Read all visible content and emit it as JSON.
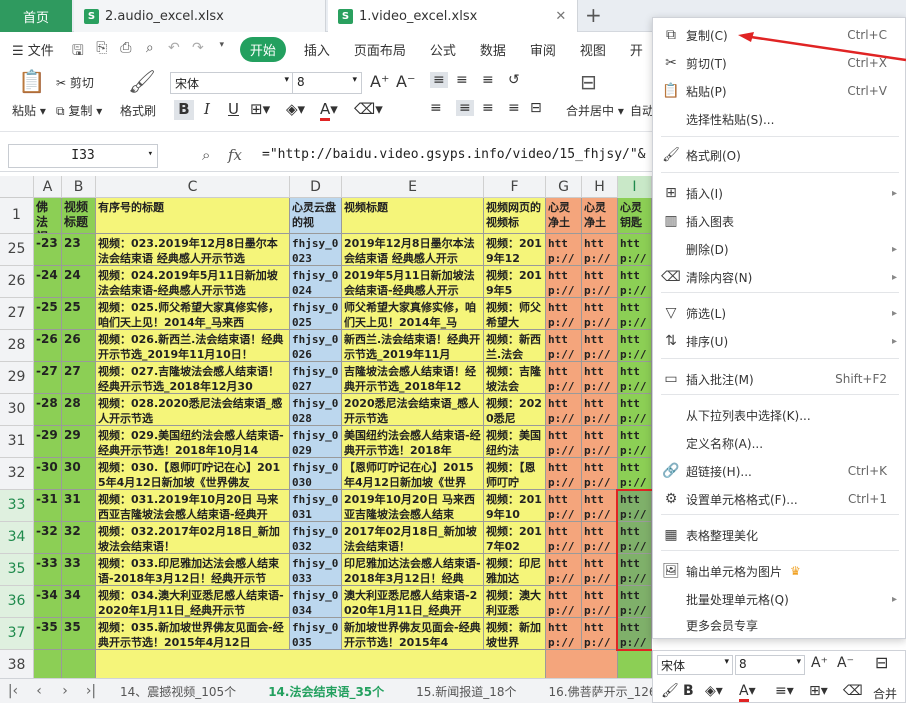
{
  "tabs": {
    "home": "首页",
    "doc1": "2.audio_excel.xlsx",
    "doc2": "1.video_excel.xlsx",
    "close": "✕"
  },
  "menu": {
    "file": "文件",
    "start": "开始",
    "insert": "插入",
    "layout": "页面布局",
    "formula": "公式",
    "data": "数据",
    "review": "审阅",
    "view": "视图",
    "dev": "开"
  },
  "ribbon": {
    "paste": "粘贴",
    "cut": "剪切",
    "copy": "复制",
    "format_painter": "格式刷",
    "font_name": "宋体",
    "font_size": "8",
    "merge": "合并居中",
    "auto": "自动"
  },
  "formula_bar": {
    "cell_ref": "I33",
    "fx": "fx",
    "content": "=\"http://baidu.video.gsyps.info/video/15_fhjsy/\"&"
  },
  "columns": [
    "A",
    "B",
    "C",
    "D",
    "E",
    "F",
    "G",
    "H",
    "I"
  ],
  "header_row": {
    "num": "1",
    "a": "佛法视频",
    "b": "视频标题",
    "c": "有序号的标题",
    "d": "心灵云盘的视",
    "e": "视频标题",
    "f": "视频网页的视频标",
    "g": "心灵净土",
    "h": "心灵净土",
    "i": "心灵钥匙"
  },
  "rows": [
    {
      "num": "25",
      "a": "-23",
      "b": "23",
      "c": "视频：023.2019年12月8日墨尔本法会结束语 经典感人开示节选",
      "d": "fhjsy_0023",
      "e": "2019年12月8日墨尔本法会结束语 经典感人开示",
      "f": "视频：2019年12",
      "g": "http://b",
      "h": "http://b",
      "i": "http://b"
    },
    {
      "num": "26",
      "a": "-24",
      "b": "24",
      "c": "视频：024.2019年5月11日新加坡法会结束语-经典感人开示节选",
      "d": "fhjsy_0024",
      "e": "2019年5月11日新加坡法会结束语-经典感人开示",
      "f": "视频：2019年5",
      "g": "http://b",
      "h": "http://b",
      "i": "http://b"
    },
    {
      "num": "27",
      "a": "-25",
      "b": "25",
      "c": "视频：025.师父希望大家真修实修，咱们天上见！2014年_马来西",
      "d": "fhjsy_0025",
      "e": "师父希望大家真修实修，咱们天上见！2014年_马",
      "f": "视频：师父希望大",
      "g": "http://b",
      "h": "http://b",
      "i": "http://b"
    },
    {
      "num": "28",
      "a": "-26",
      "b": "26",
      "c": "视频：026.新西兰.法会结束语！经典开示节选_2019年11月10日！",
      "d": "fhjsy_0026",
      "e": "新西兰.法会结束语！经典开示节选_2019年11月",
      "f": "视频：新西兰.法会",
      "g": "http://b",
      "h": "http://b",
      "i": "http://b"
    },
    {
      "num": "29",
      "a": "-27",
      "b": "27",
      "c": "视频：027.吉隆坡法会感人结束语！经典开示节选_2018年12月30",
      "d": "fhjsy_0027",
      "e": "吉隆坡法会感人结束语！经典开示节选_2018年12",
      "f": "视频：吉隆坡法会",
      "g": "http://b",
      "h": "http://b",
      "i": "http://b"
    },
    {
      "num": "30",
      "a": "-28",
      "b": "28",
      "c": "视频：028.2020悉尼法会结束语_感人开示节选",
      "d": "fhjsy_0028",
      "e": "2020悉尼法会结束语_感人开示节选",
      "f": "视频：2020悉尼",
      "g": "http://b",
      "h": "http://b",
      "i": "http://b"
    },
    {
      "num": "31",
      "a": "-29",
      "b": "29",
      "c": "视频：029.美国纽约法会感人结束语-经典开示节选！2018年10月14",
      "d": "fhjsy_0029",
      "e": "美国纽约法会感人结束语-经典开示节选！2018年",
      "f": "视频：美国纽约法",
      "g": "http://b",
      "h": "http://b",
      "i": "http://b"
    },
    {
      "num": "32",
      "a": "-30",
      "b": "30",
      "c": "视频：030.【恩师叮咛记在心】2015年4月12日新加坡《世界佛友",
      "d": "fhjsy_0030",
      "e": "【恩师叮咛记在心】2015年4月12日新加坡《世界",
      "f": "视频：【恩师叮咛",
      "g": "http://b",
      "h": "http://b",
      "i": "http://b"
    },
    {
      "num": "33",
      "a": "-31",
      "b": "31",
      "c": "视频：031.2019年10月20日 马来西亚吉隆坡法会感人结束语-经典开",
      "d": "fhjsy_0031",
      "e": "2019年10月20日 马来西亚吉隆坡法会感人结束",
      "f": "视频：2019年10",
      "g": "http://b",
      "h": "http://b",
      "i": "http://b"
    },
    {
      "num": "34",
      "a": "-32",
      "b": "32",
      "c": "视频：032.2017年02月18日_新加坡法会结束语！",
      "d": "fhjsy_0032",
      "e": "2017年02月18日_新加坡法会结束语！",
      "f": "视频：2017年02",
      "g": "http://b",
      "h": "http://b",
      "i": "http://b"
    },
    {
      "num": "35",
      "a": "-33",
      "b": "33",
      "c": "视频：033.印尼雅加达法会感人结束语-2018年3月12日！经典开示节",
      "d": "fhjsy_0033",
      "e": "印尼雅加达法会感人结束语-2018年3月12日！经典",
      "f": "视频：印尼雅加达",
      "g": "http://b",
      "h": "http://b",
      "i": "http://b"
    },
    {
      "num": "36",
      "a": "-34",
      "b": "34",
      "c": "视频：034.澳大利亚悉尼感人结束语-2020年1月11日_经典开示节",
      "d": "fhjsy_0034",
      "e": "澳大利亚悉尼感人结束语-2020年1月11日_经典开",
      "f": "视频：澳大利亚悉",
      "g": "http://b",
      "h": "http://b",
      "i": "http://b"
    },
    {
      "num": "37",
      "a": "-35",
      "b": "35",
      "c": "视频：035.新加坡世界佛友见面会-经典开示节选！2015年4月12日",
      "d": "fhjsy_0035",
      "e": "新加坡世界佛友见面会-经典开示节选！2015年4",
      "f": "视频：新加坡世界",
      "g": "http://b",
      "h": "http://b",
      "i": "http://b"
    }
  ],
  "last_row": "38",
  "sheets": [
    "14、震撼视频_105个",
    "14.法会结束语_35个",
    "15.新闻报道_18个",
    "16.佛菩萨开示_126"
  ],
  "context_menu": [
    {
      "icon": "⧉",
      "label": "复制(C)",
      "shortcut": "Ctrl+C"
    },
    {
      "icon": "✂",
      "label": "剪切(T)",
      "shortcut": "Ctrl+X"
    },
    {
      "icon": "📋",
      "label": "粘贴(P)",
      "shortcut": "Ctrl+V"
    },
    {
      "icon": "",
      "label": "选择性粘贴(S)...",
      "shortcut": ""
    },
    {
      "icon": "🖌",
      "label": "格式刷(O)",
      "shortcut": ""
    },
    {
      "icon": "⊞",
      "label": "插入(I)",
      "shortcut": ""
    },
    {
      "icon": "▥",
      "label": "插入图表",
      "shortcut": ""
    },
    {
      "icon": "",
      "label": "删除(D)",
      "shortcut": ""
    },
    {
      "icon": "⌫",
      "label": "清除内容(N)",
      "shortcut": ""
    },
    {
      "icon": "▽",
      "label": "筛选(L)",
      "shortcut": ""
    },
    {
      "icon": "⇅",
      "label": "排序(U)",
      "shortcut": ""
    },
    {
      "icon": "▭",
      "label": "插入批注(M)",
      "shortcut": "Shift+F2"
    },
    {
      "icon": "",
      "label": "从下拉列表中选择(K)...",
      "shortcut": ""
    },
    {
      "icon": "",
      "label": "定义名称(A)...",
      "shortcut": ""
    },
    {
      "icon": "🔗",
      "label": "超链接(H)...",
      "shortcut": "Ctrl+K"
    },
    {
      "icon": "⚙",
      "label": "设置单元格格式(F)...",
      "shortcut": "Ctrl+1"
    },
    {
      "icon": "▦",
      "label": "表格整理美化",
      "shortcut": ""
    },
    {
      "icon": "🖼",
      "label": "输出单元格为图片",
      "shortcut": ""
    },
    {
      "icon": "",
      "label": "批量处理单元格(Q)",
      "shortcut": ""
    },
    {
      "icon": "",
      "label": "更多会员专享",
      "shortcut": ""
    }
  ],
  "mini_toolbar": {
    "font": "宋体",
    "size": "8",
    "merge": "合并"
  },
  "colors": {
    "green": "#8ccf55",
    "yellow": "#f5f57a",
    "blue": "#bcd7ee",
    "orange": "#f4a57c",
    "accent": "#23a05f",
    "red": "#e02424"
  }
}
